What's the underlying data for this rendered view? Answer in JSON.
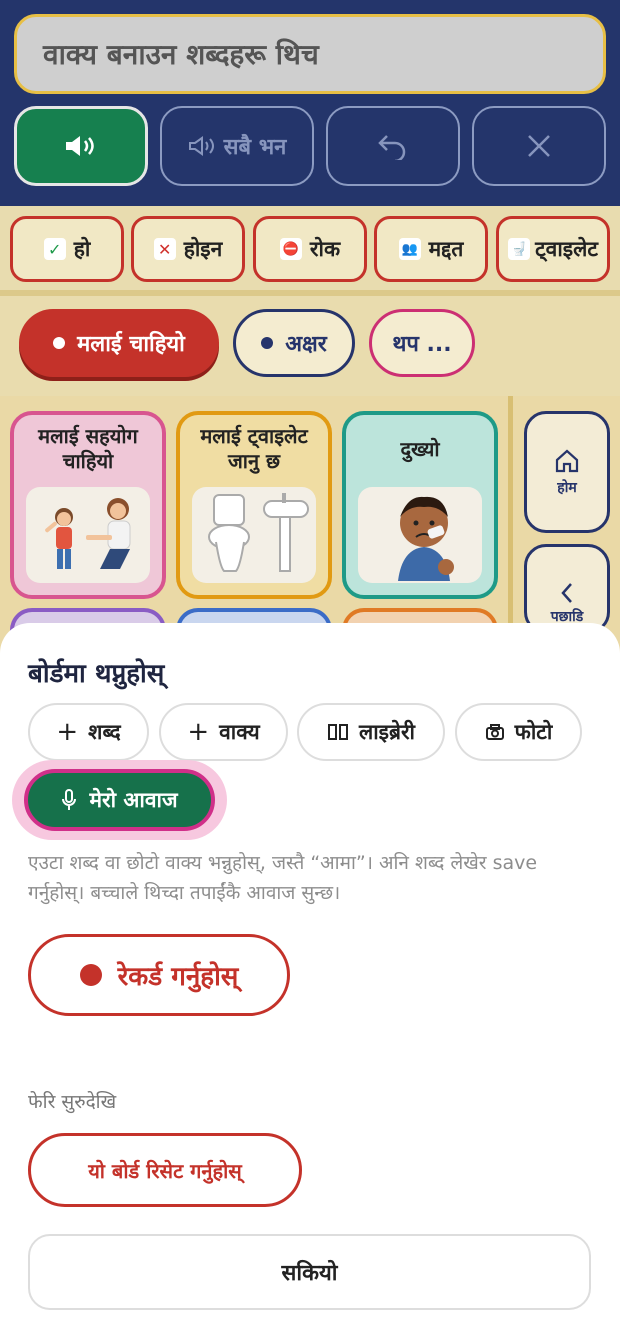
{
  "header": {
    "message_placeholder": "वाक्य बनाउन शब्दहरू थिच",
    "speak_icon": "speaker-icon",
    "speak_all_label": "सबै भन",
    "undo_icon": "undo-icon",
    "clear_icon": "close-icon"
  },
  "quick_phrases": [
    {
      "label": "हो",
      "icon": "check-icon",
      "symbol": "✓"
    },
    {
      "label": "होइन",
      "icon": "cross-icon",
      "symbol": "✕"
    },
    {
      "label": "रोक",
      "icon": "stop-sign-icon",
      "symbol": "⛔"
    },
    {
      "label": "मद्दत",
      "icon": "help-people-icon",
      "symbol": "👥"
    },
    {
      "label": "ट्वाइलेट",
      "icon": "toilet-icon",
      "symbol": "🚽"
    }
  ],
  "categories": [
    {
      "label": "मलाई चाहियो",
      "active": true
    },
    {
      "label": "अक्षर",
      "active": false
    },
    {
      "label": "थप ...",
      "active": false
    }
  ],
  "tiles": [
    {
      "label": "मलाई सहयोग चाहियो",
      "image": "helping-child-illustration"
    },
    {
      "label": "मलाई ट्वाइलेट जानु छ",
      "image": "toilet-sink-illustration"
    },
    {
      "label": "दुख्यो",
      "image": "hurt-child-illustration"
    }
  ],
  "side_nav": {
    "home_label": "होम",
    "back_label": "पछाडि"
  },
  "sheet": {
    "title": "बोर्डमा थप्नुहोस्",
    "options": [
      {
        "label": "शब्द",
        "icon": "plus-icon"
      },
      {
        "label": "वाक्य",
        "icon": "plus-icon"
      },
      {
        "label": "लाइब्रेरी",
        "icon": "library-icon"
      },
      {
        "label": "फोटो",
        "icon": "camera-icon"
      }
    ],
    "voice_label": "मेरो आवाज",
    "help_text": "एउटा शब्द वा छोटो वाक्य भन्नुहोस्, जस्तै “आमा”। अनि शब्द लेखेर save गर्नुहोस्। बच्चाले थिच्दा तपाईंकै आवाज सुन्छ।",
    "record_label": "रेकर्ड गर्नुहोस्",
    "reset_section_label": "फेरि सुरुदेखि",
    "reset_label": "यो बोर्ड रिसेट गर्नुहोस्",
    "done_label": "सकियो"
  },
  "colors": {
    "header_bg": "#24356b",
    "accent_green": "#16804f",
    "accent_red": "#c4322a",
    "accent_pink": "#d02f89",
    "board_bg": "#e9dcae"
  }
}
